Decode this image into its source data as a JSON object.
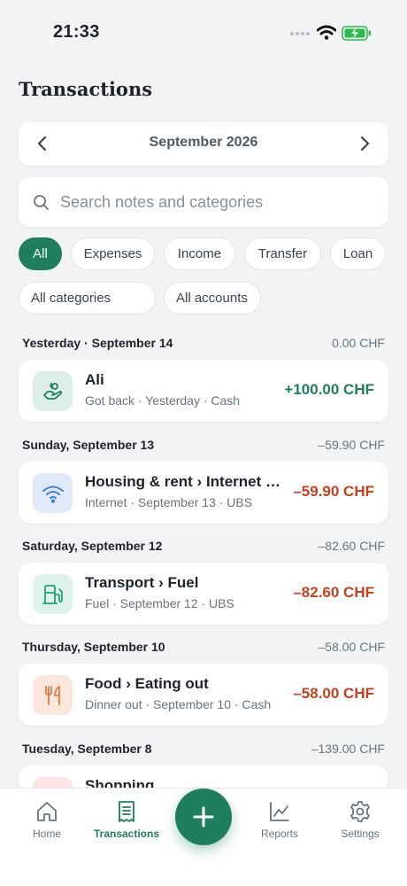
{
  "status": {
    "time": "21:33"
  },
  "header": {
    "title": "Transactions"
  },
  "month": {
    "label": "September 2026"
  },
  "search": {
    "placeholder": "Search notes and categories",
    "value": ""
  },
  "filters": {
    "types": [
      "All",
      "Expenses",
      "Income",
      "Transfer",
      "Loan"
    ],
    "active_type": "All",
    "category_select": "All categories",
    "account_select": "All accounts"
  },
  "groups": [
    {
      "day": "Yesterday · September 14",
      "total": "0.00 CHF",
      "items": [
        {
          "title": "Ali",
          "subtitle": "Got back · Yesterday · Cash",
          "amount": "+100.00 CHF",
          "icon": "handshake-icon",
          "kind": "positive"
        }
      ]
    },
    {
      "day": "Sunday, September 13",
      "total": "–59.90 CHF",
      "items": [
        {
          "title": "Housing & rent › Internet & …",
          "subtitle": "Internet · September 13 · UBS",
          "amount": "–59.90 CHF",
          "icon": "wifi-icon",
          "kind": "negative"
        }
      ]
    },
    {
      "day": "Saturday, September 12",
      "total": "–82.60 CHF",
      "items": [
        {
          "title": "Transport › Fuel",
          "subtitle": "Fuel · September 12 · UBS",
          "amount": "–82.60 CHF",
          "icon": "fuel-pump-icon",
          "kind": "negative"
        }
      ]
    },
    {
      "day": "Thursday, September 10",
      "total": "–58.00 CHF",
      "items": [
        {
          "title": "Food › Eating out",
          "subtitle": "Dinner out · September 10 · Cash",
          "amount": "–58.00 CHF",
          "icon": "utensils-icon",
          "kind": "negative"
        }
      ]
    },
    {
      "day": "Tuesday, September 8",
      "total": "–139.00 CHF",
      "items": [
        {
          "title": "Shopping",
          "subtitle": "",
          "amount": "",
          "icon": "shopping-bag-icon",
          "kind": "negative"
        }
      ]
    }
  ],
  "tabs": [
    {
      "label": "Home",
      "icon": "home-icon"
    },
    {
      "label": "Transactions",
      "icon": "receipt-icon",
      "active": true
    },
    {
      "label": "Reports",
      "icon": "chart-icon"
    },
    {
      "label": "Settings",
      "icon": "gear-icon"
    }
  ],
  "fab": {
    "icon": "plus-icon"
  },
  "colors": {
    "accent": "#1e7e5d",
    "negative": "#c8401f",
    "background": "#f2f3f5"
  }
}
